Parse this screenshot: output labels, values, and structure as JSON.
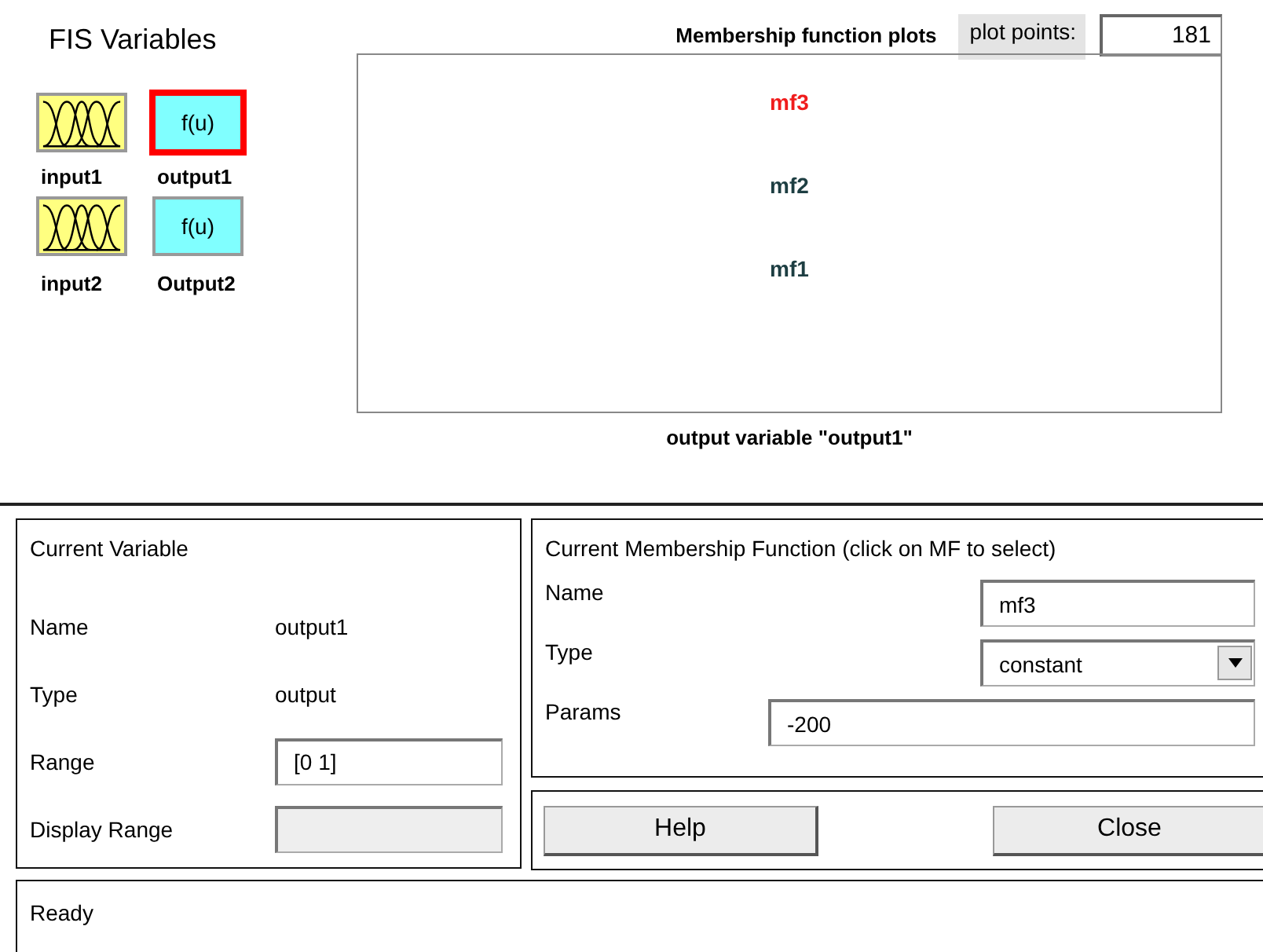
{
  "fis_variables": {
    "title": "FIS Variables",
    "variables": [
      {
        "name": "input1",
        "kind": "input",
        "selected": false
      },
      {
        "name": "output1",
        "kind": "output",
        "label": "f(u)",
        "selected": true
      },
      {
        "name": "input2",
        "kind": "input",
        "selected": false
      },
      {
        "name": "Output2",
        "kind": "output",
        "label": "f(u)",
        "selected": false
      }
    ]
  },
  "plot": {
    "title": "Membership function plots",
    "plot_points_label": "plot points:",
    "plot_points": "181",
    "functions": [
      {
        "name": "mf3",
        "selected": true
      },
      {
        "name": "mf2",
        "selected": false
      },
      {
        "name": "mf1",
        "selected": false
      }
    ],
    "caption": "output variable \"output1\""
  },
  "current_variable": {
    "title": "Current Variable",
    "fields": [
      {
        "label": "Name",
        "kind": "text",
        "value": "output1"
      },
      {
        "label": "Type",
        "kind": "text",
        "value": "output"
      },
      {
        "label": "Range",
        "kind": "input",
        "value": "[0 1]"
      },
      {
        "label": "Display Range",
        "kind": "input",
        "disabled": true
      }
    ]
  },
  "current_mf": {
    "title": "Current Membership Function (click on MF to select)",
    "name_label": "Name",
    "name": "mf3",
    "type_label": "Type",
    "type": "constant",
    "params_label": "Params",
    "params": "-200"
  },
  "buttons": [
    "Help",
    "Close"
  ],
  "status": "Ready"
}
